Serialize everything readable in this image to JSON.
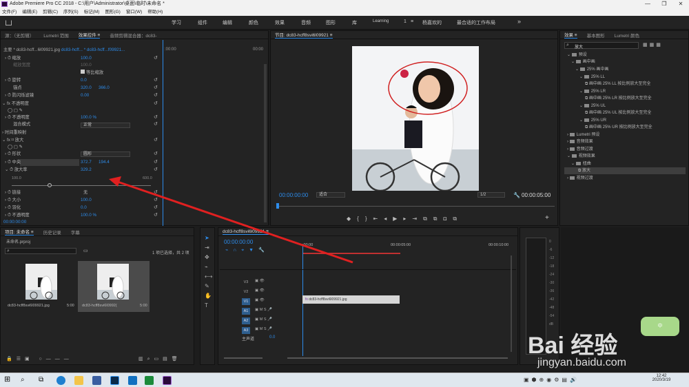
{
  "window": {
    "title": "Adobe Premiere Pro CC 2018 - C:\\用户\\Administrator\\桌面\\临时\\未命名 *",
    "controls": [
      "—",
      "❐",
      "✕"
    ]
  },
  "menu": [
    "文件(F)",
    "编辑(E)",
    "剪辑(C)",
    "序列(S)",
    "标记(M)",
    "图形(G)",
    "窗口(W)",
    "帮助(H)"
  ],
  "workspaces": [
    "学习",
    "组件",
    "编辑",
    "颜色",
    "效果",
    "音频",
    "图形",
    "库",
    "Learning",
    "1",
    "≡",
    "杨嘉欢的",
    "最合适的工作布局"
  ],
  "source": {
    "tabs": [
      "源：（无剪辑）",
      "Lumetri 范围",
      "效果控件 ≡",
      "音频剪辑混合器：dc83-"
    ],
    "clip_master": "主要 * dc83-hcff...6l09921.jpg",
    "clip_seq": "dc83-hcff... * dc83-hcff...f09921...",
    "timecode_start": ":00:00",
    "timecode_end": "00:00",
    "props": {
      "scale": "缩放",
      "scale_w": "缩放宽度",
      "scale_val": "100.0",
      "scale_w_val": "100.0",
      "uniform": "等比缩放",
      "rotate": "旋转",
      "rotate_val": "0.0",
      "anchor": "锚点",
      "anchor_x": "320.0",
      "anchor_y": "366.0",
      "flicker": "防闪烁滤镜",
      "flicker_val": "0.00"
    },
    "opacity_fx": "不透明度",
    "opacity": "不透明度",
    "opacity_val": "100.0 %",
    "blend": "混合模式",
    "blend_val": "正常",
    "time_remap": "时间重映射",
    "magnify_fx": "放大",
    "shape": "形状",
    "shape_val": "圆形",
    "center": "中央",
    "center_x": "372.7",
    "center_y": "194.4",
    "mag": "放大率",
    "mag_val": "329.2",
    "slider_min": "100.0",
    "slider_max": "600.0",
    "link": "链接",
    "link_val": "无",
    "size": "大小",
    "size_val": "100.0",
    "feather": "羽化",
    "feather_val": "0.0",
    "opacity2": "不透明度",
    "opacity2_val": "100.0 %",
    "tc": "00:00:00:00"
  },
  "program": {
    "title": "节目: dc83-hcff8svi6l09921 ≡",
    "tc": "00:00:00:00",
    "fit": "适合",
    "ratio": "1/2",
    "dur": "00:00:05:00"
  },
  "effects": {
    "tabs": [
      "效果 ≡",
      "基本图形",
      "Lumetri 颜色"
    ],
    "search": "放大",
    "search_icon": "search-icon",
    "tree": [
      "预设",
      "画中画",
      "25% 画中画",
      "25% LL",
      "画中画 25% LL 按比例放大至完全",
      "25% LR",
      "画中画 25% LR 按比例放大至完全",
      "25% UL",
      "画中画 25% UL 按比例放大至完全",
      "25% UR",
      "画中画 25% UR 按比例放大至完全",
      "Lumetri 预设",
      "音频效果",
      "音频过渡",
      "视频效果",
      "扭曲",
      "放大",
      "视频过渡"
    ]
  },
  "project": {
    "tabs": [
      "项目: 未命名 ≡",
      "历史记录",
      "字幕"
    ],
    "file": "未命名.prproj",
    "sel": "1 项已选择，共 2 项",
    "items": [
      {
        "name": "dc83-hcff8svi6l09921.jpg",
        "dur": "5:00"
      },
      {
        "name": "dc83-hcff8svi6l0992(",
        "dur": "5:00"
      }
    ]
  },
  "timeline": {
    "title": "dc83-hcff8svi6l09921 ≡",
    "tc": "00:00:00:00",
    "ruler": [
      ":00:00",
      "00:00:05:00",
      "00:00:10:00"
    ],
    "tracks": [
      "V3",
      "V2",
      "V1",
      "A1",
      "A2",
      "A3"
    ],
    "master": "主声道",
    "master_val": "0.0",
    "clip": "dc83-hcff8svi6l09921.jpg"
  },
  "taskbar": {
    "time": "12:42",
    "date": "2020/3/19",
    "ime": "中"
  },
  "watermark": {
    "text": "Bai  经验",
    "url": "jingyan.baidu.com"
  },
  "colors": {
    "accent": "#2d8ceb",
    "arrow": "#e02020",
    "ellipse": "#d02020"
  }
}
